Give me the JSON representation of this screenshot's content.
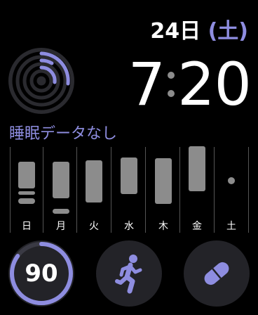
{
  "colors": {
    "accent": "#8e8de0",
    "background": "#000000",
    "complication_bg": "#232328",
    "bar": "#8c8c8c"
  },
  "date": {
    "day": "24日",
    "weekday": "(土)"
  },
  "time": {
    "hours": "7",
    "minutes": "20"
  },
  "activity_ring": {
    "icon": "activity-rings-icon"
  },
  "sleep": {
    "title": "睡眠データなし"
  },
  "chart_data": {
    "type": "bar",
    "categories": [
      "日",
      "月",
      "火",
      "水",
      "木",
      "金",
      "土"
    ],
    "title": "",
    "xlabel": "",
    "ylabel": ""
  },
  "score": {
    "value": "90",
    "progress": 0.85
  },
  "workout": {
    "icon": "running-figure-icon"
  },
  "medications": {
    "icon": "pill-icon"
  }
}
